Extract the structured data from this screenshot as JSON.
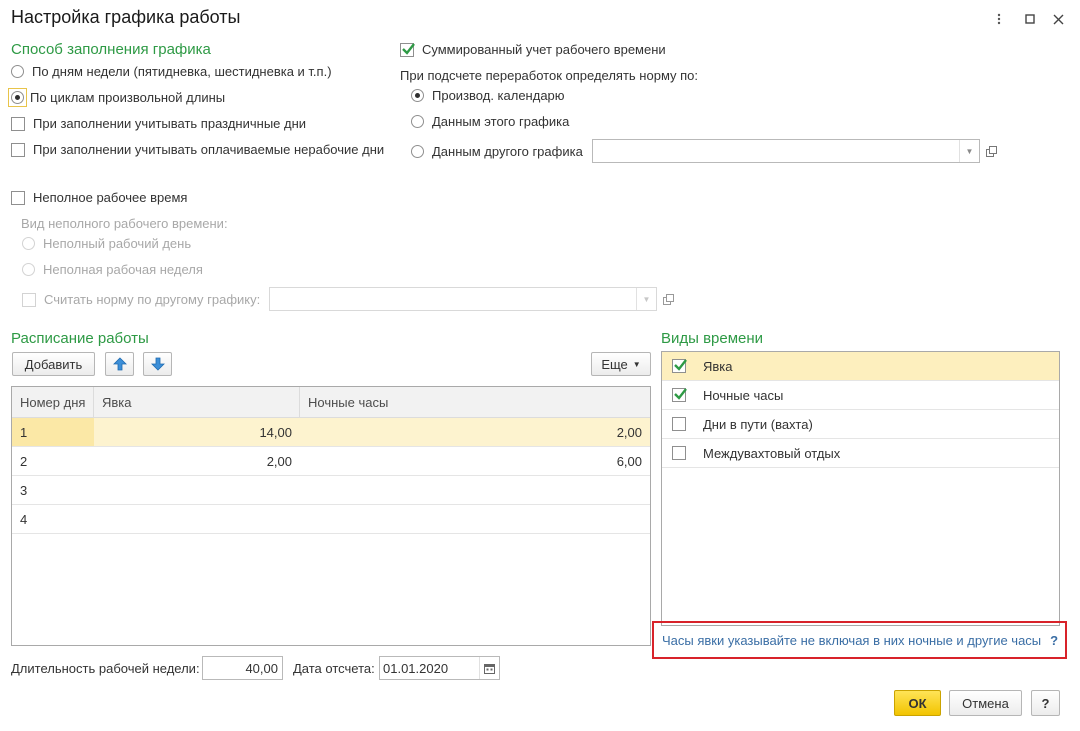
{
  "window": {
    "title": "Настройка графика работы",
    "controls": {
      "menu_icon": "more-vertical-icon",
      "maximize_icon": "maximize-icon",
      "close_icon": "close-icon"
    }
  },
  "fill_method": {
    "section_title": "Способ заполнения графика",
    "option_weekdays": "По дням недели (пятидневка, шестидневка и т.п.)",
    "option_cycles": "По циклам произвольной длины",
    "selected": "option_cycles",
    "holidays_checkbox": "При заполнении учитывать праздничные дни",
    "paid_nonworking_checkbox": "При заполнении учитывать оплачиваемые нерабочие дни"
  },
  "summarized": {
    "checkbox_label": "Суммированный учет рабочего времени",
    "checked": true,
    "norm_caption": "При подсчете переработок определять норму по:",
    "option_calendar": "Производ. календарю",
    "option_this_schedule": "Данным этого графика",
    "option_other_schedule": "Данным другого графика",
    "selected": "option_calendar",
    "other_schedule_value": ""
  },
  "part_time": {
    "checkbox_label": "Неполное рабочее время",
    "checked": false,
    "kind_caption": "Вид неполного рабочего времени:",
    "option_day": "Неполный рабочий день",
    "option_week": "Неполная рабочая неделя",
    "other_norm_checkbox": "Считать норму по другому графику:",
    "other_norm_value": ""
  },
  "schedule": {
    "section_title": "Расписание работы",
    "add_button": "Добавить",
    "more_button": "Еще",
    "columns": [
      "Номер дня",
      "Явка",
      "Ночные часы"
    ],
    "rows": [
      {
        "day": "1",
        "attendance": "14,00",
        "night": "2,00"
      },
      {
        "day": "2",
        "attendance": "2,00",
        "night": "6,00"
      },
      {
        "day": "3",
        "attendance": "",
        "night": ""
      },
      {
        "day": "4",
        "attendance": "",
        "night": ""
      }
    ],
    "selected_row": 0
  },
  "time_types": {
    "section_title": "Виды времени",
    "items": [
      {
        "label": "Явка",
        "checked": true
      },
      {
        "label": "Ночные часы",
        "checked": true
      },
      {
        "label": "Дни в пути (вахта)",
        "checked": false
      },
      {
        "label": "Междувахтовый отдых",
        "checked": false
      }
    ],
    "hint": "Часы явки указывайте не включая в них ночные и другие часы",
    "hint_help": "?"
  },
  "footer": {
    "week_length_label": "Длительность рабочей недели:",
    "week_length_value": "40,00",
    "start_date_label": "Дата отсчета:",
    "start_date_value": "01.01.2020",
    "ok_button": "ОК",
    "cancel_button": "Отмена",
    "help_button": "?"
  },
  "colors": {
    "section_green": "#2e9a45",
    "accent_yellow": "#f2c400",
    "selection_yellow": "#fbe8a6",
    "hint_border": "#d8232a",
    "hint_text": "#3a6ea5",
    "check_green": "#2e9a45"
  }
}
